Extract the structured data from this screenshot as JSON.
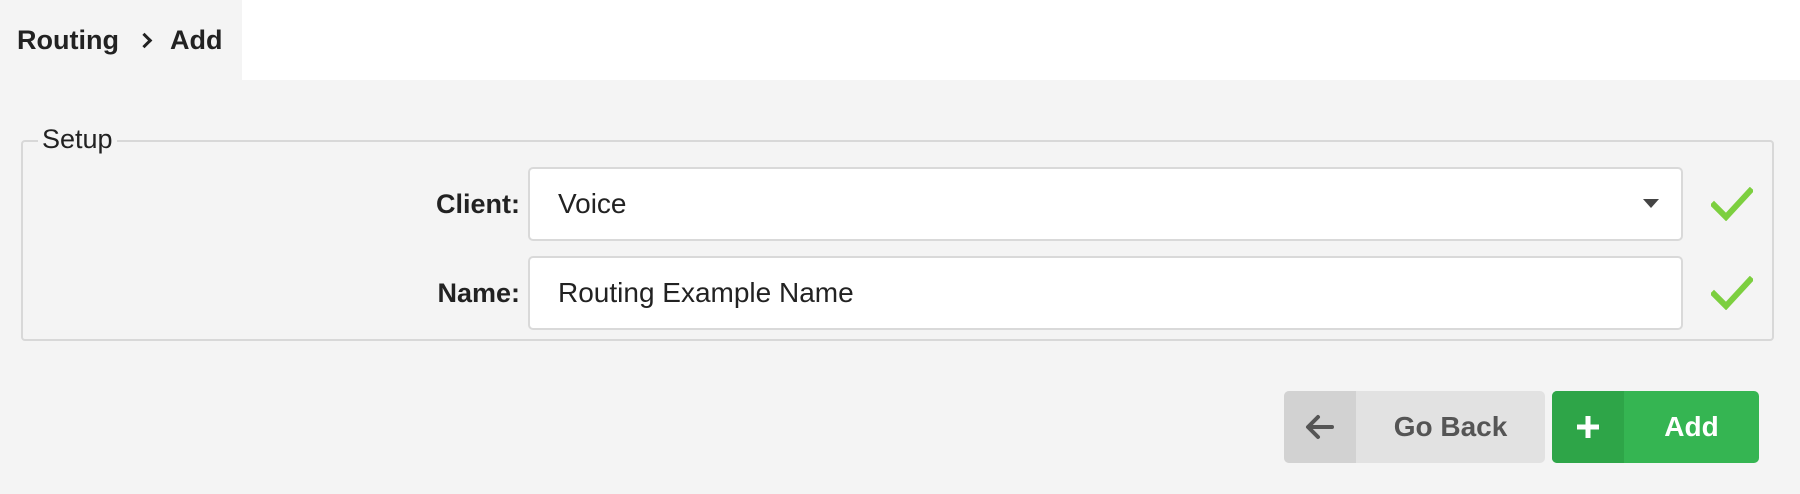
{
  "breadcrumb": {
    "items": [
      "Routing",
      "Add"
    ]
  },
  "setup": {
    "legend": "Setup",
    "client": {
      "label": "Client:",
      "value": "Voice"
    },
    "name": {
      "label": "Name:",
      "value": "Routing Example Name"
    }
  },
  "actions": {
    "go_back_label": "Go Back",
    "add_label": "Add"
  },
  "icons": {
    "separator": "chevron-right-icon",
    "dropdown": "caret-down-icon",
    "valid": "checkmark-icon",
    "back": "arrow-left-icon",
    "add": "plus-icon"
  },
  "colors": {
    "success": "#7ccf3f",
    "add_button": "#35b552",
    "back_button": "#e2e2e2"
  }
}
